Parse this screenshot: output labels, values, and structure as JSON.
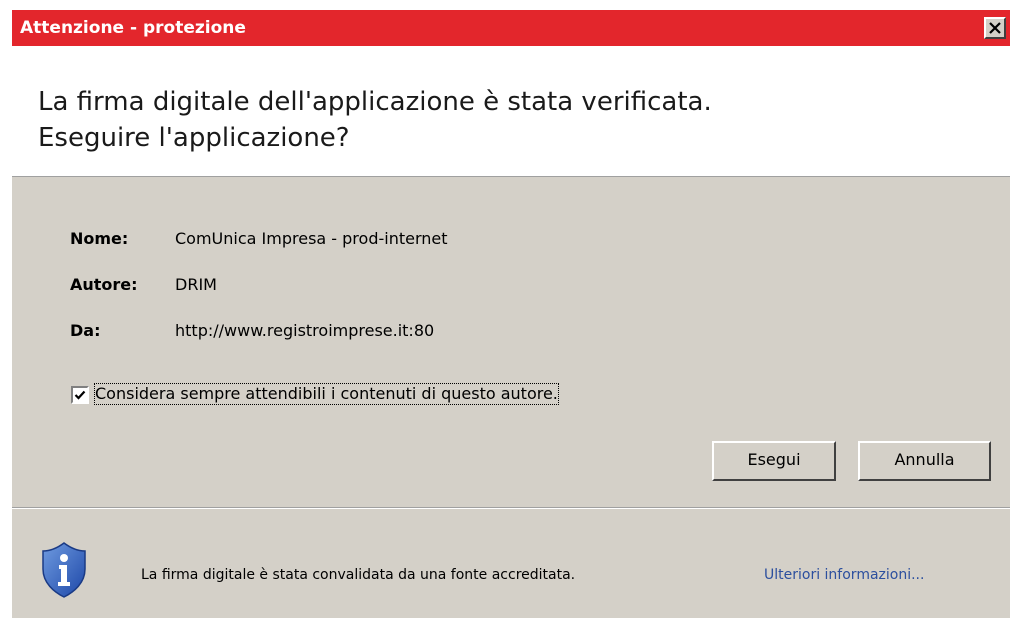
{
  "window": {
    "title": "Attenzione - protezione",
    "title_bar_color": "#e3262c",
    "close_icon": "close-icon"
  },
  "header": {
    "line1": "La firma digitale dell'applicazione è stata verificata.",
    "line2": "Eseguire l'applicazione?"
  },
  "details": {
    "name_label": "Nome:",
    "name_value": "ComUnica Impresa - prod-internet",
    "author_label": "Autore:",
    "author_value": "DRIM",
    "from_label": "Da:",
    "from_value": "http://www.registroimprese.it:80"
  },
  "trust_checkbox": {
    "checked": true,
    "label": "Considera sempre attendibili i contenuti di questo autore."
  },
  "buttons": {
    "run_label": "Esegui",
    "cancel_label": "Annulla"
  },
  "footer": {
    "icon": "shield-info-icon",
    "message": "La firma digitale è stata convalidata da una fonte accreditata.",
    "more_info_label": "Ulteriori informazioni...",
    "link_color": "#2c4f9e"
  }
}
